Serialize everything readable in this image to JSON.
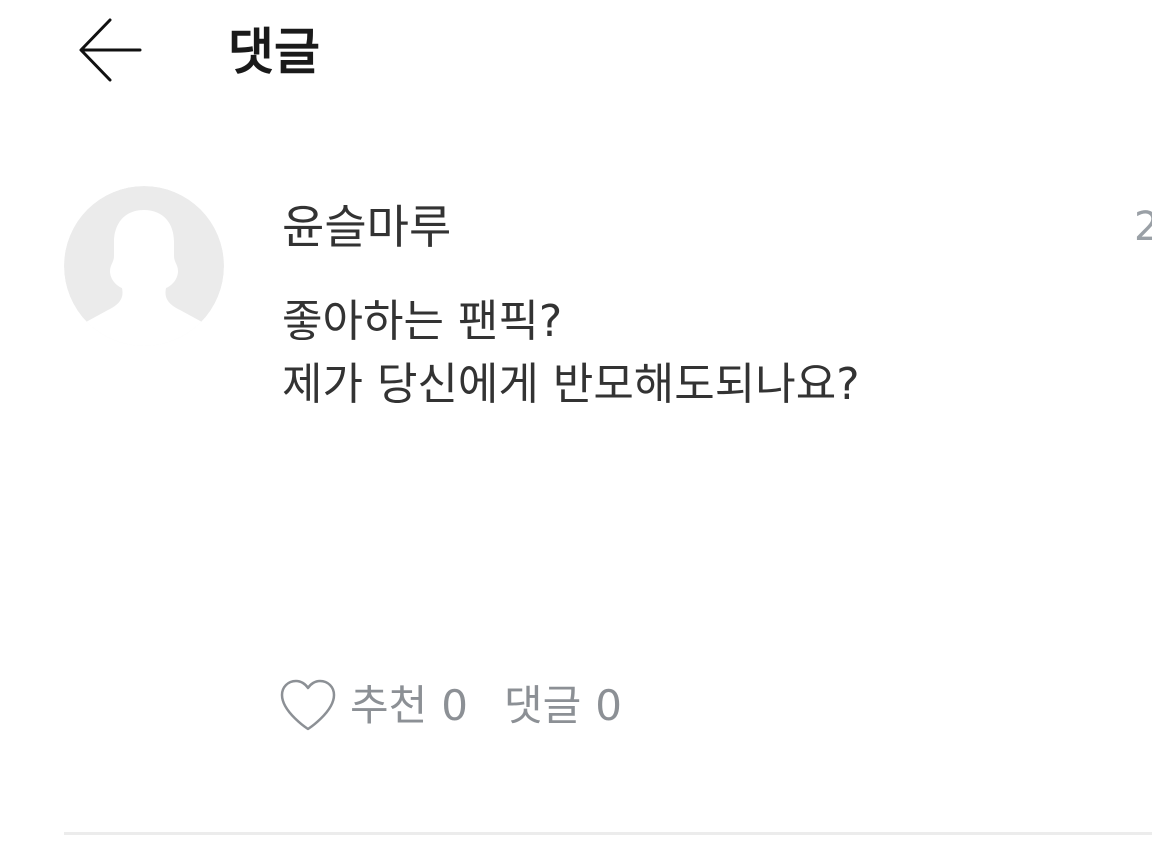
{
  "header": {
    "back_icon": "arrow-left-icon",
    "title": "댓글"
  },
  "comment": {
    "avatar_icon": "default-user-silhouette-icon",
    "author": "윤슬마루",
    "date_partial": "2",
    "text": "좋아하는 팬픽?\n제가 당신에게 반모해도되나요?",
    "actions": {
      "like_icon": "heart-outline-icon",
      "like_label": "추천",
      "like_count": "0",
      "reply_label": "댓글",
      "reply_count": "0"
    }
  },
  "colors": {
    "title_text": "#1a1a1a",
    "body_text": "#333333",
    "muted_text": "#8c9095",
    "avatar_bg": "#ebebeb",
    "avatar_silhouette": "#ffffff",
    "divider": "#ececec"
  }
}
